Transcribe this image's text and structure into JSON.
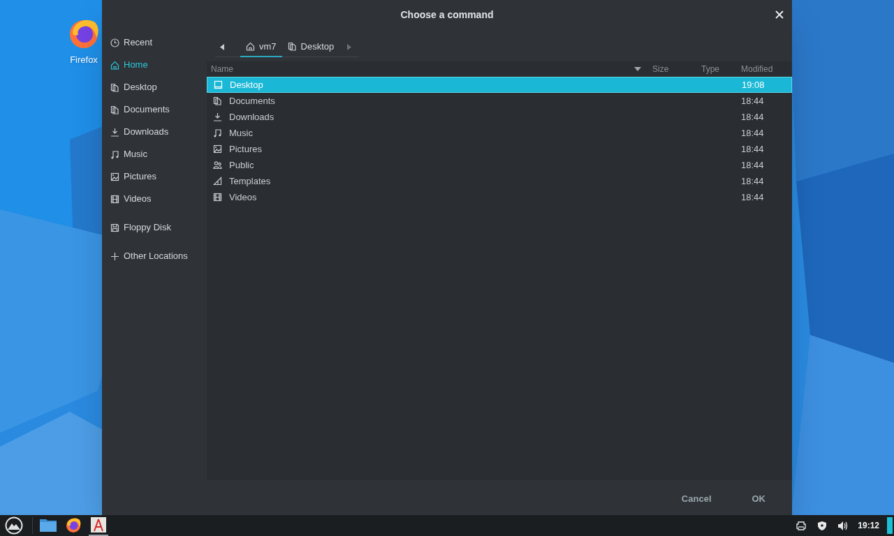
{
  "desktop_icons": [
    {
      "label": "Firefox"
    }
  ],
  "window": {
    "title": "Choose a command"
  },
  "sidebar": {
    "sections": [
      [
        {
          "label": "Recent",
          "selected": false
        },
        {
          "label": "Home",
          "selected": true
        },
        {
          "label": "Desktop",
          "selected": false
        },
        {
          "label": "Documents",
          "selected": false
        },
        {
          "label": "Downloads",
          "selected": false
        },
        {
          "label": "Music",
          "selected": false
        },
        {
          "label": "Pictures",
          "selected": false
        },
        {
          "label": "Videos",
          "selected": false
        }
      ],
      [
        {
          "label": "Floppy Disk",
          "selected": false
        }
      ],
      [
        {
          "label": "Other Locations",
          "selected": false
        }
      ]
    ]
  },
  "path_bar": [
    {
      "label": "vm7",
      "selected": true
    },
    {
      "label": "Desktop",
      "selected": false
    }
  ],
  "table": {
    "columns": [
      "Name",
      "Size",
      "Type",
      "Modified"
    ],
    "rows": [
      {
        "name": "Desktop",
        "modified": "19:08",
        "selected": true
      },
      {
        "name": "Documents",
        "modified": "18:44",
        "selected": false
      },
      {
        "name": "Downloads",
        "modified": "18:44",
        "selected": false
      },
      {
        "name": "Music",
        "modified": "18:44",
        "selected": false
      },
      {
        "name": "Pictures",
        "modified": "18:44",
        "selected": false
      },
      {
        "name": "Public",
        "modified": "18:44",
        "selected": false
      },
      {
        "name": "Templates",
        "modified": "18:44",
        "selected": false
      },
      {
        "name": "Videos",
        "modified": "18:44",
        "selected": false
      }
    ]
  },
  "buttons": [
    "Cancel",
    "OK"
  ],
  "taskbar": {
    "apps": [
      {
        "active": false
      },
      {
        "active": false
      },
      {
        "active": true
      }
    ],
    "clock": "19:12"
  }
}
